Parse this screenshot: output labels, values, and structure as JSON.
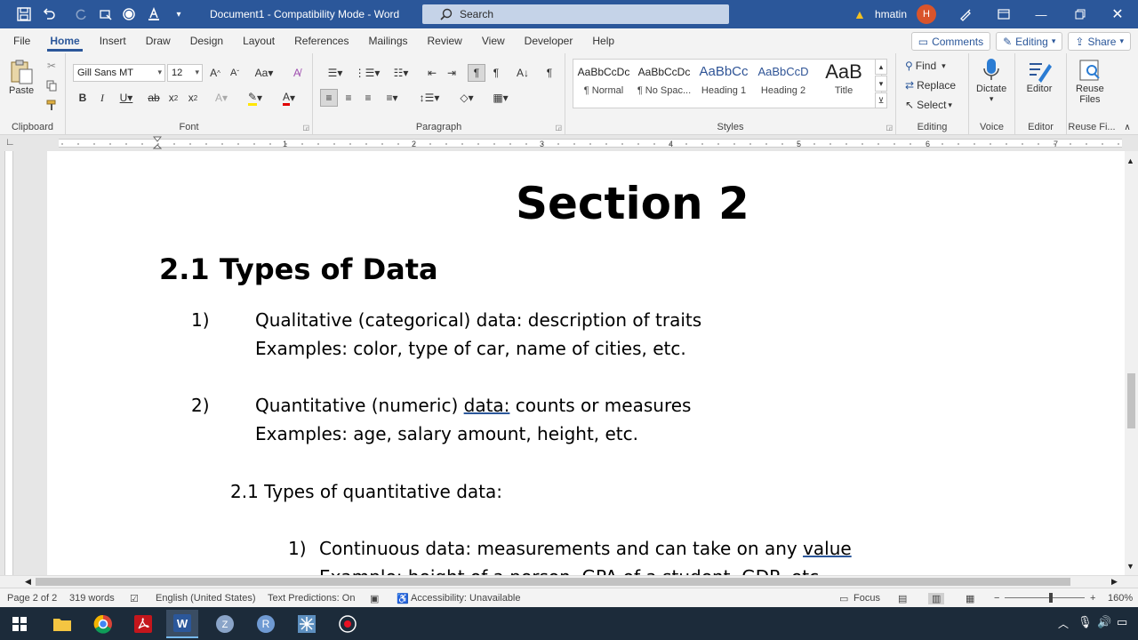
{
  "titlebar": {
    "doc_title": "Document1  -  Compatibility Mode  -  Word",
    "search_label": "Search",
    "user_name": "hmatin",
    "avatar_initial": "H"
  },
  "tabs": [
    "File",
    "Home",
    "Insert",
    "Draw",
    "Design",
    "Layout",
    "References",
    "Mailings",
    "Review",
    "View",
    "Developer",
    "Help"
  ],
  "tab_actions": {
    "comments": "Comments",
    "editing": "Editing",
    "share": "Share"
  },
  "ribbon": {
    "clipboard": {
      "paste": "Paste",
      "label": "Clipboard"
    },
    "font": {
      "name": "Gill Sans MT",
      "size": "12",
      "label": "Font"
    },
    "paragraph": {
      "label": "Paragraph"
    },
    "styles": {
      "label": "Styles",
      "items": [
        {
          "preview": "AaBbCcDc",
          "name": "¶ Normal"
        },
        {
          "preview": "AaBbCcDc",
          "name": "¶ No Spac..."
        },
        {
          "preview": "AaBbCc",
          "name": "Heading 1"
        },
        {
          "preview": "AaBbCcD",
          "name": "Heading 2"
        },
        {
          "preview": "AaB",
          "name": "Title"
        }
      ]
    },
    "editing": {
      "find": "Find",
      "replace": "Replace",
      "select": "Select",
      "label": "Editing"
    },
    "voice": {
      "dictate": "Dictate",
      "label": "Voice"
    },
    "editor": {
      "editor": "Editor",
      "label": "Editor"
    },
    "reuse": {
      "line1": "Reuse",
      "line2": "Files",
      "label": "Reuse Fi..."
    }
  },
  "document": {
    "section_title": "Section 2",
    "heading": "2.1 Types of Data",
    "items": [
      {
        "num": "1)",
        "line1": "Qualitative (categorical) data: description of traits",
        "line2": "Examples: color, type of car, name of cities, etc."
      },
      {
        "num": "2)",
        "line1_a": "Quantitative (numeric) ",
        "line1_u": "data:",
        "line1_b": " counts or measures",
        "line2": "Examples: age, salary amount, height, etc."
      }
    ],
    "subheading": "2.1 Types of quantitative data:",
    "sub_item": {
      "num": "1)",
      "text_a": "Continuous data: measurements and can take on any ",
      "text_u": "value",
      "cut_line": "Example: height of a person, GPA of a student, GDP, etc."
    }
  },
  "statusbar": {
    "page": "Page 2 of 2",
    "words": "319 words",
    "language": "English (United States)",
    "predictions": "Text Predictions: On",
    "accessibility": "Accessibility: Unavailable",
    "focus": "Focus",
    "zoom": "160%"
  },
  "colors": {
    "brand": "#2b579a",
    "ribbon_bg": "#f3f3f3",
    "taskbar": "#1c2b3a"
  }
}
